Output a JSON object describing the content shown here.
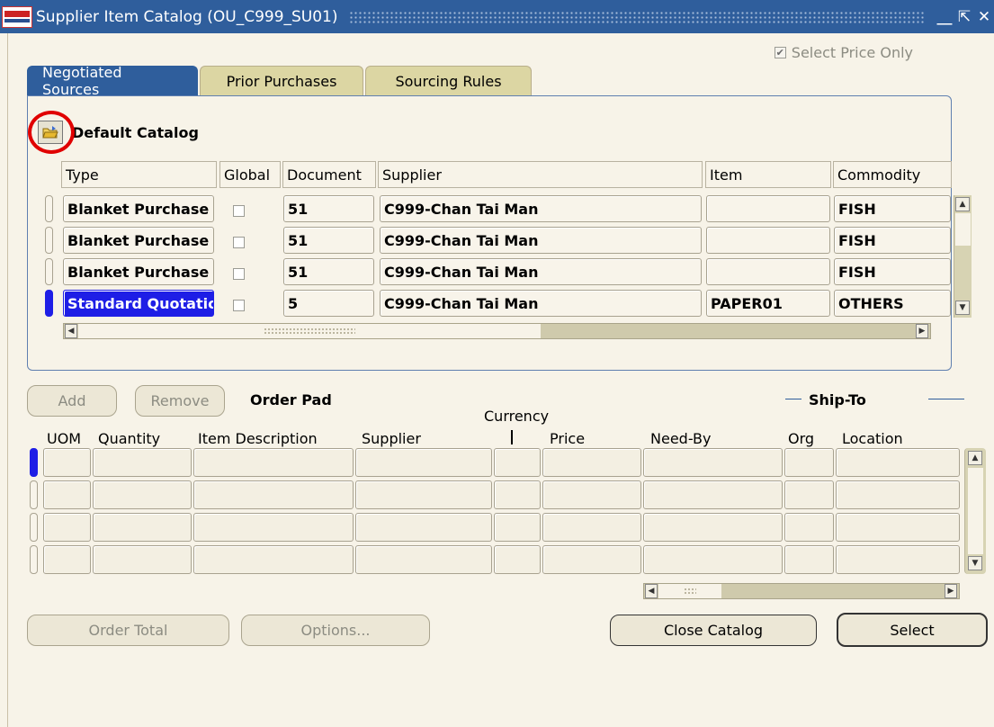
{
  "window": {
    "title": "Supplier Item Catalog (OU_C999_SU01)",
    "min_icon": "minimize-icon",
    "max_icon": "maximize-icon",
    "close_icon": "close-icon"
  },
  "select_price_only": {
    "label": "Select Price Only",
    "checked": true
  },
  "tabs": [
    {
      "label": "Negotiated Sources",
      "active": true
    },
    {
      "label": "Prior Purchases",
      "active": false
    },
    {
      "label": "Sourcing Rules",
      "active": false
    }
  ],
  "catalog": {
    "title": "Default Catalog",
    "folder_icon": "folder-open-icon",
    "columns": [
      "Type",
      "Global",
      "Document",
      "Supplier",
      "Item",
      "Commodity"
    ],
    "rows": [
      {
        "type": "Blanket Purchase",
        "global": false,
        "document": "51",
        "supplier": "C999-Chan Tai Man",
        "item": "",
        "commodity": "FISH"
      },
      {
        "type": "Blanket Purchase",
        "global": false,
        "document": "51",
        "supplier": "C999-Chan Tai Man",
        "item": "",
        "commodity": "FISH"
      },
      {
        "type": "Blanket Purchase",
        "global": false,
        "document": "51",
        "supplier": "C999-Chan Tai Man",
        "item": "",
        "commodity": "FISH"
      },
      {
        "type": "Standard Quotatic",
        "global": false,
        "document": "5",
        "supplier": "C999-Chan Tai Man",
        "item": "PAPER01",
        "commodity": "OTHERS",
        "selected": true
      }
    ]
  },
  "order_pad": {
    "title": "Order Pad",
    "add_label": "Add",
    "remove_label": "Remove",
    "ship_to_label": "Ship-To",
    "currency_label": "Currency",
    "columns": [
      "UOM",
      "Quantity",
      "Item Description",
      "Supplier",
      "Price",
      "Need-By",
      "Org",
      "Location"
    ]
  },
  "buttons": {
    "order_total": "Order Total",
    "options": "Options...",
    "close_catalog": "Close Catalog",
    "select": "Select"
  }
}
